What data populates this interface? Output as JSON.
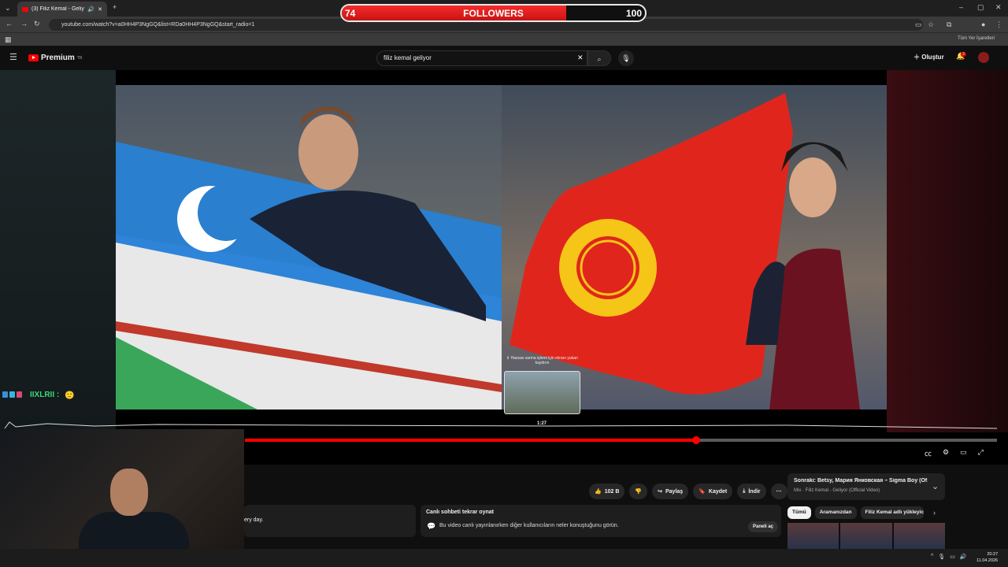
{
  "browser": {
    "tab_title": "(3) Filiz Kemal - Geliyor (Of",
    "url": "youtube.com/watch?v=a0HH4P3NgGQ&list=RDa0HH4P3NgGQ&start_radio=1",
    "bookmarks_label": "Tüm Yer İşaretleri"
  },
  "followers": {
    "current": "74",
    "label": "FOLLOWERS",
    "goal": "100",
    "progress_fraction": 0.74,
    "colors": {
      "fill": "#e02020",
      "border": "#e8e8e8"
    }
  },
  "youtube": {
    "logo": "Premium",
    "logo_region": "TR",
    "search_value": "filiz kemal geliyor",
    "create_label": "Oluştur",
    "notification_count": "3"
  },
  "player": {
    "tooltip": "⇕ Hassas sarma işlemi için ekranı yukarı kaydırın",
    "hover_time": "1:27",
    "played_fraction": 0.6
  },
  "chat": {
    "username": "IIXLRII :"
  },
  "actions": {
    "likes": "102 B",
    "share": "Paylaş",
    "save": "Kaydet",
    "download": "İndir"
  },
  "description": {
    "snippet": "ery day."
  },
  "chat_replay": {
    "title": "Canlı sohbeti tekrar oynat",
    "desc": "Bu video canlı yayınlanırken diğer kullanıcıların neler konuştuğunu görün.",
    "button": "Paneli aç"
  },
  "up_next": {
    "title": "Sonraki: Betsy, Мария Янковская – Sigma Boy (Of...",
    "subtitle": "Mix · Filiz Kemal - Geliyor (Official Video)",
    "chips": [
      "Tümü",
      "Aramanızdan",
      "Filiz Kemal adlı yükleyici"
    ]
  },
  "taskbar": {
    "time": "20:27",
    "date": "11.04.2026"
  }
}
